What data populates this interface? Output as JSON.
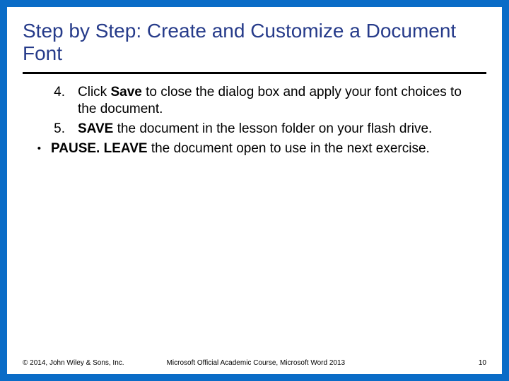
{
  "title": "Step by Step: Create and Customize a Document Font",
  "steps": [
    {
      "num": "4.",
      "segments": [
        {
          "text": "Click ",
          "bold": false
        },
        {
          "text": "Save",
          "bold": true
        },
        {
          "text": " to close the dialog box and apply your font choices to the document.",
          "bold": false
        }
      ]
    },
    {
      "num": "5.",
      "segments": [
        {
          "text": " ",
          "bold": false
        },
        {
          "text": "SAVE",
          "bold": true
        },
        {
          "text": " the document in the lesson folder on your flash drive.",
          "bold": false
        }
      ]
    }
  ],
  "bullet": {
    "mark": "•",
    "segments": [
      {
        "text": "PAUSE. LEAVE",
        "bold": true
      },
      {
        "text": " the document open to use in the next exercise.",
        "bold": false
      }
    ]
  },
  "footer": {
    "left": "© 2014, John Wiley & Sons, Inc.",
    "center": "Microsoft Official Academic Course, Microsoft Word 2013",
    "right": "10"
  }
}
